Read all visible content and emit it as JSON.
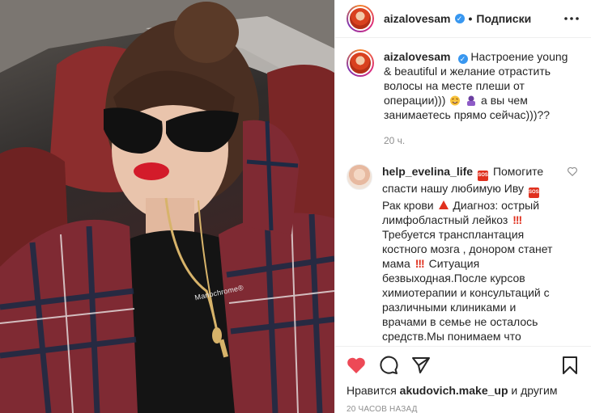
{
  "post": {
    "photo_caption": "Manochrome®",
    "header": {
      "username": "aizalovesam",
      "separator": "•",
      "follow_label": "Подписки"
    },
    "caption": {
      "username": "aizalovesam",
      "text_1": "Настроение young & beautiful и желание отрастить волосы на месте плеши от операции)))",
      "text_2": "а вы чем занимаетесь прямо сейчас)))??",
      "time": "20 ч."
    },
    "comment": {
      "username": "help_evelina_life",
      "text_1": "Помогите спасти нашу любимую Иву",
      "text_2": "Рак крови",
      "text_3": "Диагноз: острый лимфобластный лейкоз",
      "text_4": "Требуется трансплантация костного мозга , донором станет мама",
      "text_5": "Ситуация безвыходная.После курсов химиотерапии и консультаций с различными клиниками и врачами в семье не осталось средств.Мы понимаем что",
      "sos_label": "SOS",
      "bang": "!!!"
    },
    "likes": {
      "prefix": "Нравится",
      "user": "akudovich.make_up",
      "suffix": "и другим"
    },
    "timestamp": "20 часов назад"
  },
  "colors": {
    "accent_blue": "#3897f0",
    "heart_red": "#ed4956",
    "sos_red": "#e0301e"
  },
  "icons": [
    "more-horizontal-icon",
    "heart-filled-icon",
    "comment-icon",
    "share-icon",
    "bookmark-icon",
    "heart-outline-icon",
    "verified-icon"
  ]
}
